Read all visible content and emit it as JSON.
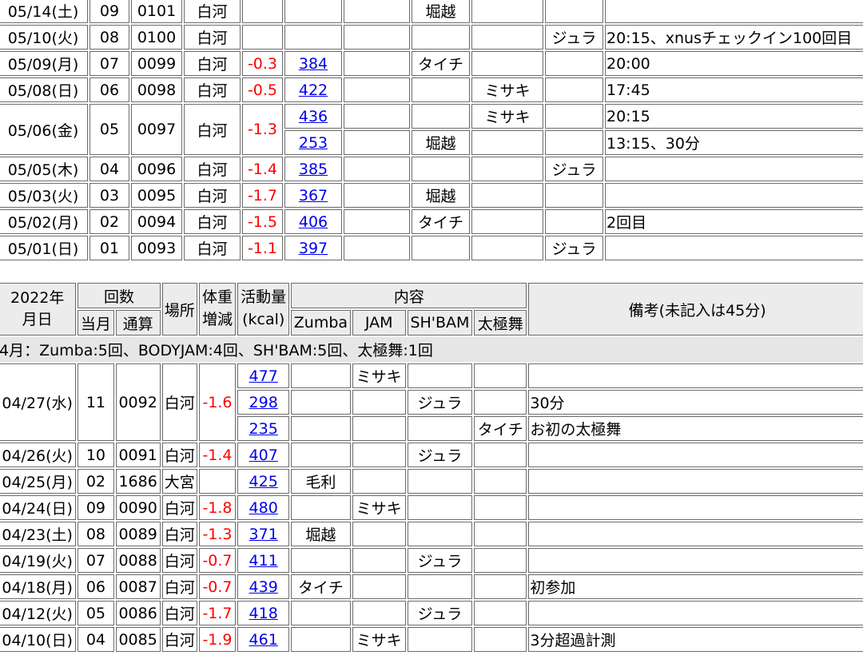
{
  "upper_rows": [
    {
      "date": "05/14(土)",
      "month_count": "09",
      "total_count": "0101",
      "place": "白河",
      "weight": "",
      "kcal": "",
      "zumba": "",
      "jam": "堀越",
      "shbam": "",
      "taikyoku": "",
      "note": ""
    },
    {
      "date": "05/10(火)",
      "month_count": "08",
      "total_count": "0100",
      "place": "白河",
      "weight": "",
      "kcal": "",
      "zumba": "",
      "jam": "",
      "shbam": "",
      "taikyoku": "ジュラ",
      "note": "20:15、xnusチェックイン100回目"
    },
    {
      "date": "05/09(月)",
      "month_count": "07",
      "total_count": "0099",
      "place": "白河",
      "weight": "-0.3",
      "kcal": "384",
      "zumba": "",
      "jam": "タイチ",
      "shbam": "",
      "taikyoku": "",
      "note": "20:00"
    },
    {
      "date": "05/08(日)",
      "month_count": "06",
      "total_count": "0098",
      "place": "白河",
      "weight": "-0.5",
      "kcal": "422",
      "zumba": "",
      "jam": "",
      "shbam": "ミサキ",
      "taikyoku": "",
      "note": "17:45"
    },
    {
      "date": "05/06(金)",
      "month_count": "05",
      "total_count": "0097",
      "place": "白河",
      "weight": "-1.3",
      "kcal": "436",
      "zumba": "",
      "jam": "",
      "shbam": "ミサキ",
      "taikyoku": "",
      "note": "20:15"
    },
    {
      "kcal": "253",
      "zumba": "",
      "jam": "堀越",
      "shbam": "",
      "taikyoku": "",
      "note": "13:15、30分"
    },
    {
      "date": "05/05(木)",
      "month_count": "04",
      "total_count": "0096",
      "place": "白河",
      "weight": "-1.4",
      "kcal": "385",
      "zumba": "",
      "jam": "",
      "shbam": "",
      "taikyoku": "ジュラ",
      "note": ""
    },
    {
      "date": "05/03(火)",
      "month_count": "03",
      "total_count": "0095",
      "place": "白河",
      "weight": "-1.7",
      "kcal": "367",
      "zumba": "",
      "jam": "堀越",
      "shbam": "",
      "taikyoku": "",
      "note": ""
    },
    {
      "date": "05/02(月)",
      "month_count": "02",
      "total_count": "0094",
      "place": "白河",
      "weight": "-1.5",
      "kcal": "406",
      "zumba": "",
      "jam": "タイチ",
      "shbam": "",
      "taikyoku": "",
      "note": "2回目"
    },
    {
      "date": "05/01(日)",
      "month_count": "01",
      "total_count": "0093",
      "place": "白河",
      "weight": "-1.1",
      "kcal": "397",
      "zumba": "",
      "jam": "",
      "shbam": "",
      "taikyoku": "ジュラ",
      "note": ""
    }
  ],
  "header": {
    "year": "2022年",
    "month_day": "月日",
    "count": "回数",
    "this_month": "当月",
    "cumulative": "通算",
    "place": "場所",
    "weight_1": "体重",
    "weight_2": "増減",
    "activity_1": "活動量",
    "activity_2": "(kcal)",
    "content": "内容",
    "zumba": "Zumba",
    "jam": "JAM",
    "shbam": "SH'BAM",
    "taikyoku": "太極舞",
    "notes": "備考(未記入は45分)"
  },
  "month_summary": "4月：Zumba:5回、BODYJAM:4回、SH'BAM:5回、太極舞:1回",
  "lower_rows": [
    {
      "date": "04/27(水)",
      "month_count": "11",
      "total_count": "0092",
      "place": "白河",
      "weight": "-1.6",
      "kcal": "477",
      "zumba": "",
      "jam": "ミサキ",
      "shbam": "",
      "taikyoku": "",
      "note": ""
    },
    {
      "kcal": "298",
      "zumba": "",
      "jam": "",
      "shbam": "ジュラ",
      "taikyoku": "",
      "note": "30分"
    },
    {
      "kcal": "235",
      "zumba": "",
      "jam": "",
      "shbam": "",
      "taikyoku": "タイチ",
      "note": "お初の太極舞"
    },
    {
      "date": "04/26(火)",
      "month_count": "10",
      "total_count": "0091",
      "place": "白河",
      "weight": "-1.4",
      "kcal": "407",
      "zumba": "",
      "jam": "",
      "shbam": "ジュラ",
      "taikyoku": "",
      "note": ""
    },
    {
      "date": "04/25(月)",
      "month_count": "02",
      "total_count": "1686",
      "place": "大宮",
      "weight": "",
      "kcal": "425",
      "zumba": "毛利",
      "jam": "",
      "shbam": "",
      "taikyoku": "",
      "note": ""
    },
    {
      "date": "04/24(日)",
      "month_count": "09",
      "total_count": "0090",
      "place": "白河",
      "weight": "-1.8",
      "kcal": "480",
      "zumba": "",
      "jam": "ミサキ",
      "shbam": "",
      "taikyoku": "",
      "note": ""
    },
    {
      "date": "04/23(土)",
      "month_count": "08",
      "total_count": "0089",
      "place": "白河",
      "weight": "-1.3",
      "kcal": "371",
      "zumba": "堀越",
      "jam": "",
      "shbam": "",
      "taikyoku": "",
      "note": ""
    },
    {
      "date": "04/19(火)",
      "month_count": "07",
      "total_count": "0088",
      "place": "白河",
      "weight": "-0.7",
      "kcal": "411",
      "zumba": "",
      "jam": "",
      "shbam": "ジュラ",
      "taikyoku": "",
      "note": ""
    },
    {
      "date": "04/18(月)",
      "month_count": "06",
      "total_count": "0087",
      "place": "白河",
      "weight": "-0.7",
      "kcal": "439",
      "zumba": "タイチ",
      "jam": "",
      "shbam": "",
      "taikyoku": "",
      "note": "初参加"
    },
    {
      "date": "04/12(火)",
      "month_count": "05",
      "total_count": "0086",
      "place": "白河",
      "weight": "-1.7",
      "kcal": "418",
      "zumba": "",
      "jam": "",
      "shbam": "ジュラ",
      "taikyoku": "",
      "note": ""
    },
    {
      "date": "04/10(日)",
      "month_count": "04",
      "total_count": "0085",
      "place": "白河",
      "weight": "-1.9",
      "kcal": "461",
      "zumba": "",
      "jam": "ミサキ",
      "shbam": "",
      "taikyoku": "",
      "note": "3分超過計測"
    }
  ]
}
